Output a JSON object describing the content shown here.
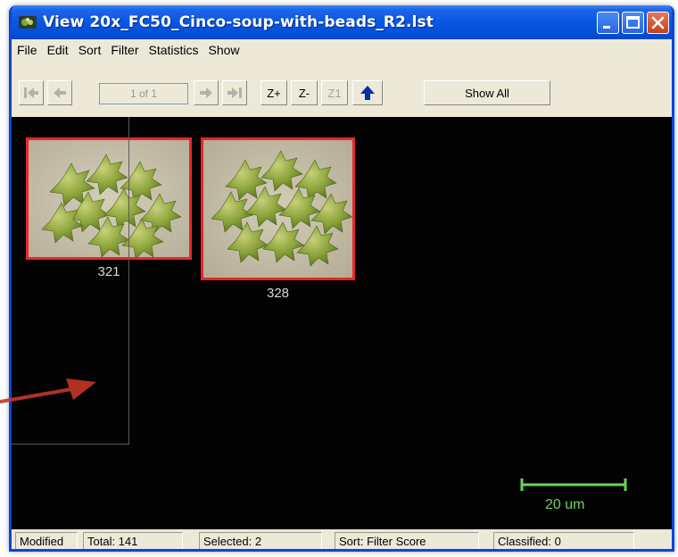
{
  "window": {
    "title": "View  20x_FC50_Cinco-soup-with-beads_R2.lst"
  },
  "menu": {
    "items": [
      "File",
      "Edit",
      "Sort",
      "Filter",
      "Statistics",
      "Show"
    ]
  },
  "toolbar": {
    "page_indicator": "1 of 1",
    "zoom_in_label": "Z+",
    "zoom_out_label": "Z-",
    "zoom_reset_label": "Z1",
    "show_all_label": "Show All"
  },
  "viewer": {
    "thumbnails": [
      {
        "id": "321"
      },
      {
        "id": "328"
      }
    ],
    "scale_label": "20 um",
    "scale_color": "#6bd35a"
  },
  "status": {
    "modified": "Modified",
    "total": "Total: 141",
    "selected": "Selected: 2",
    "sort": "Sort: Filter Score",
    "classified": "Classified: 0"
  },
  "colors": {
    "title_blue": "#0a58e4",
    "selection_red": "#e8262a",
    "annotation_arrow": "#c23a2a"
  }
}
